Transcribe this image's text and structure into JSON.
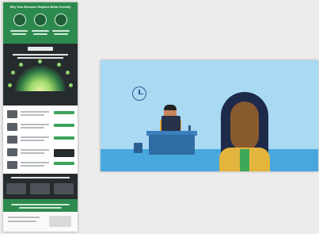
{
  "thumbnail": {
    "header_title": "Why Your Resource Requires Better Security"
  },
  "illustration": {
    "scene": "office"
  },
  "colors": {
    "background": "#ececec",
    "brand_green": "#2d8a4e",
    "dark": "#262b2e",
    "sky": "#a9d9f3",
    "floor": "#48a8dd"
  }
}
